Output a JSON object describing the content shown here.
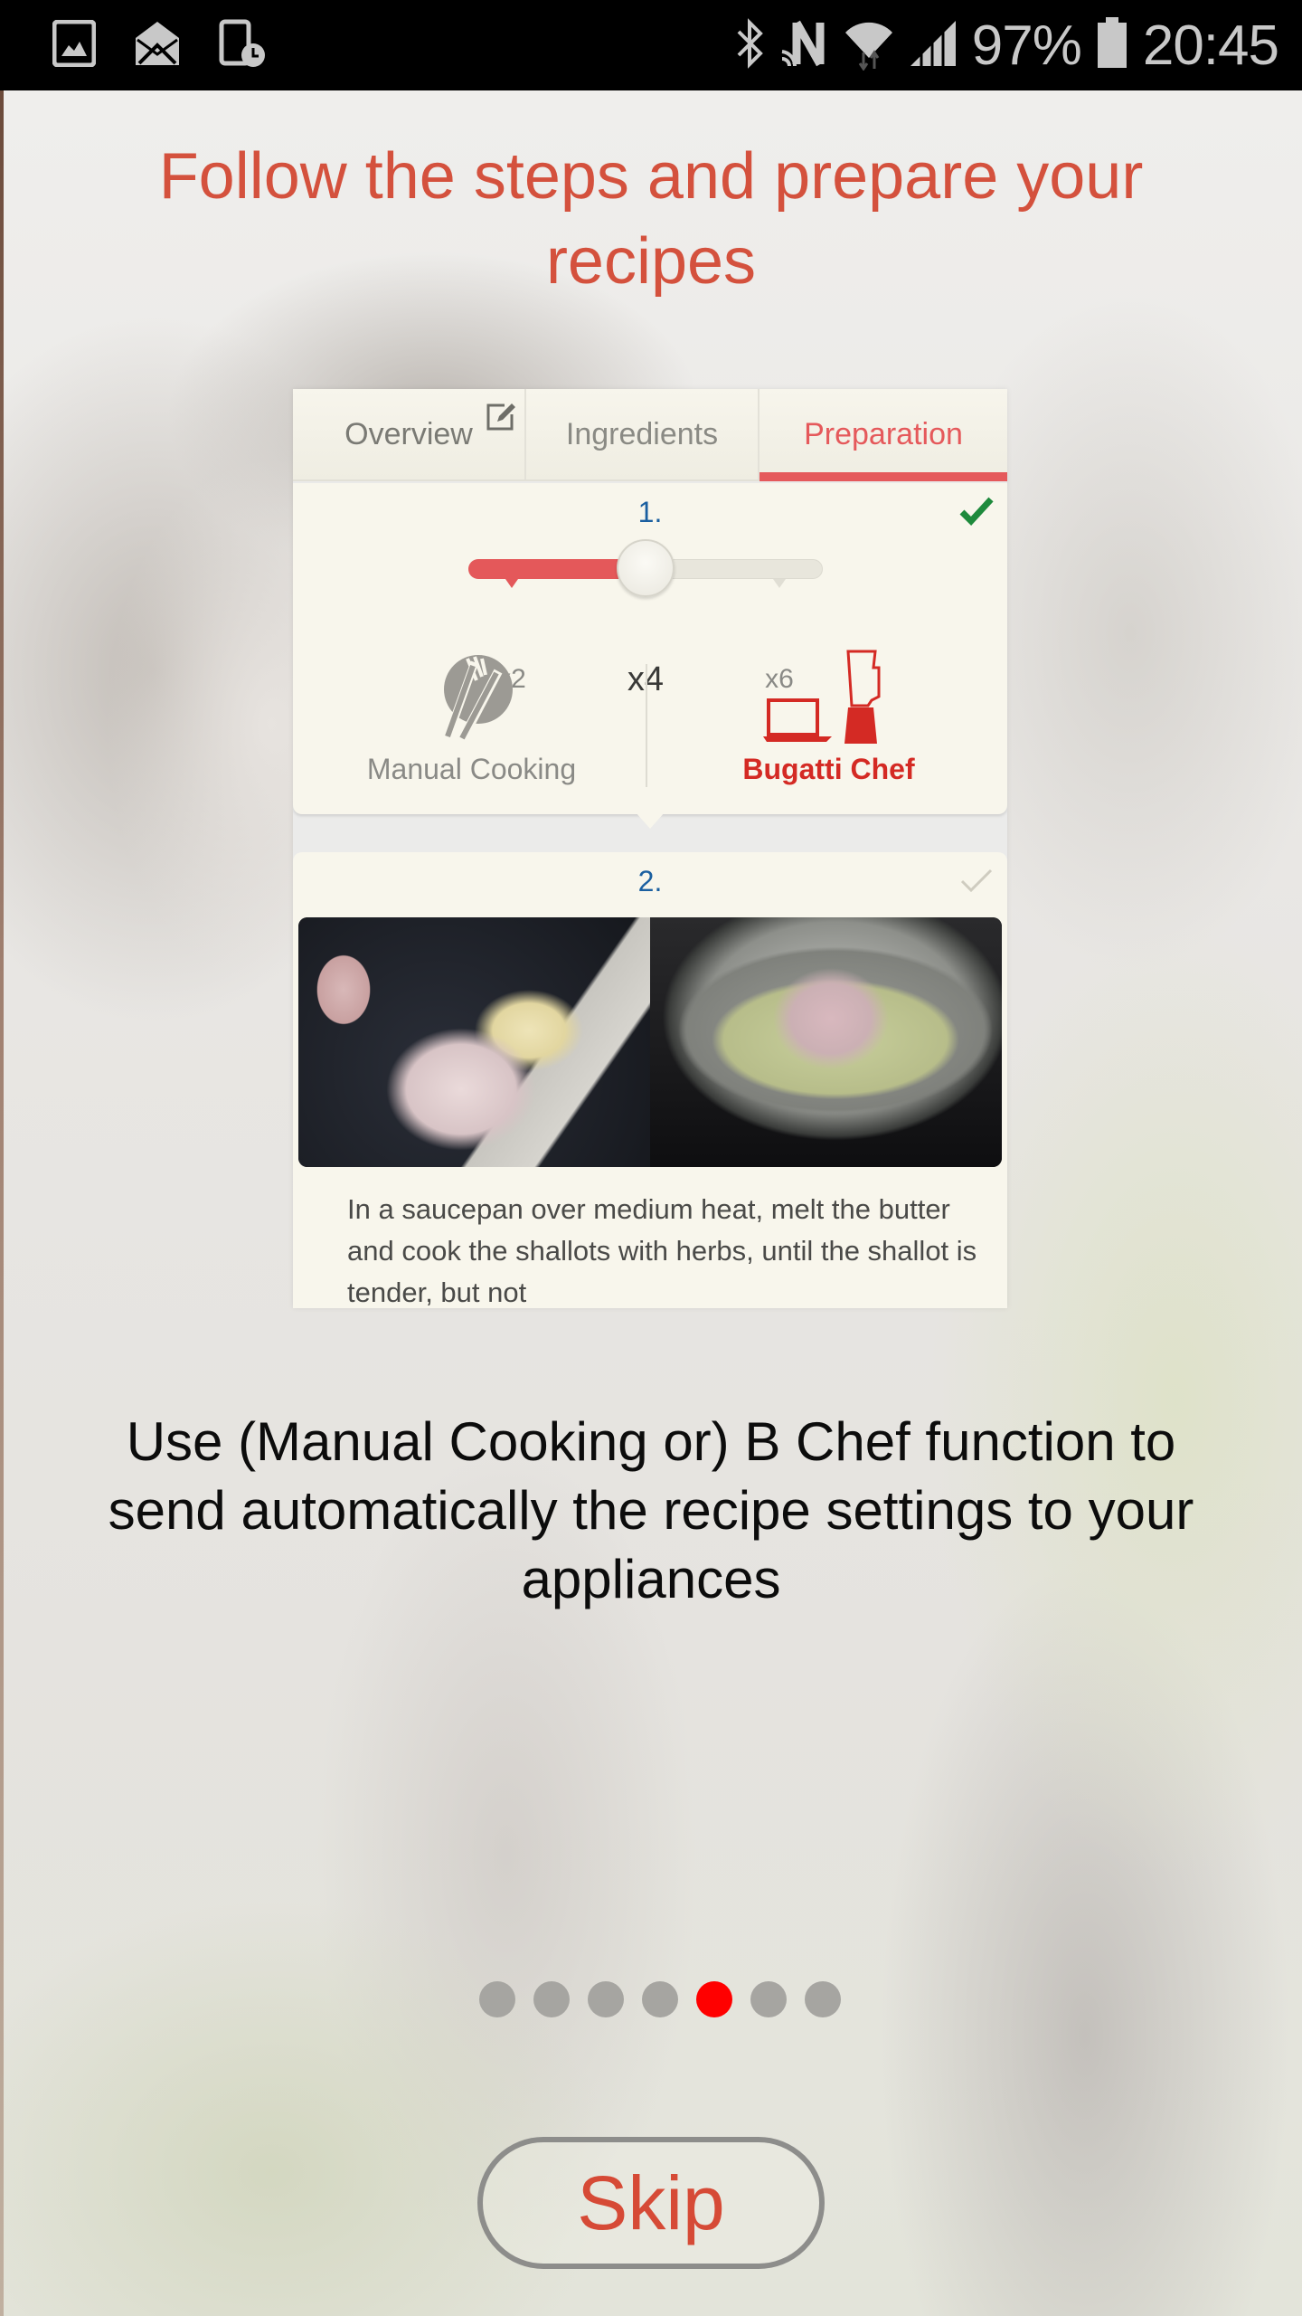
{
  "status_bar": {
    "left_icons": [
      "gallery-notification-icon",
      "email-notification-icon",
      "device-schedule-icon"
    ],
    "right_icons": [
      "bluetooth-icon",
      "nfc-icon",
      "wifi-icon",
      "cellular-signal-icon"
    ],
    "battery_percent": "97%",
    "battery_level": 0.97,
    "time": "20:45"
  },
  "headline": "Follow the steps and prepare your recipes",
  "card": {
    "tabs": [
      {
        "label": "Overview",
        "icon": "edit-icon",
        "active": false
      },
      {
        "label": "Ingredients",
        "active": false
      },
      {
        "label": "Preparation",
        "active": true
      }
    ],
    "step1": {
      "number": "1.",
      "completed": true,
      "servings_slider": {
        "options": [
          "x2",
          "x4",
          "x6"
        ],
        "selected": "x4",
        "selected_index": 1
      },
      "modes": [
        {
          "label": "Manual Cooking",
          "icon": "cutlery-plate-icon",
          "selected": false
        },
        {
          "label": "Bugatti Chef",
          "icon": "laptop-blender-icon",
          "selected": true
        }
      ]
    },
    "step2": {
      "number": "2.",
      "completed": false,
      "images": [
        "chopped-shallots-photo",
        "shallots-in-saucepan-photo"
      ],
      "text": "In a saucepan over medium heat, melt the butter and cook the shallots with herbs, until the shallot is tender, but not"
    }
  },
  "description": "Use (Manual Cooking or) B Chef function to send automatically the recipe settings to your appliances",
  "pager": {
    "total": 7,
    "current_index": 4
  },
  "skip_label": "Skip",
  "colors": {
    "accent": "#d4513d",
    "pager_active": "#ff0000",
    "pager_inactive": "#a6a5a1",
    "tab_active": "#e5595b",
    "chef_red": "#d42a24",
    "step_number": "#1a5fa0",
    "check_green": "#1e8a3c"
  }
}
